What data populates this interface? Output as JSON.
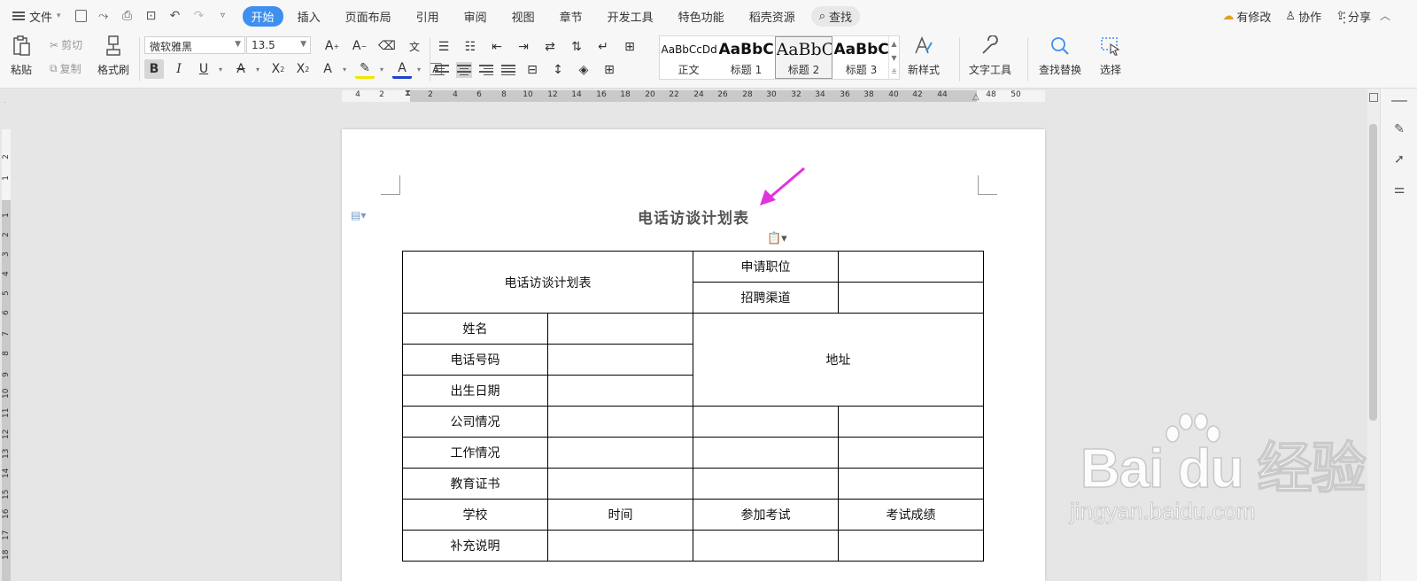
{
  "menubar": {
    "file_label": "文件",
    "tabs": [
      "开始",
      "插入",
      "页面布局",
      "引用",
      "审阅",
      "视图",
      "章节",
      "开发工具",
      "特色功能",
      "稻壳资源"
    ],
    "active_tab": "开始",
    "search_label": "查找",
    "modified_label": "有修改",
    "collab_label": "协作",
    "share_label": "分享"
  },
  "ribbon": {
    "paste_label": "粘贴",
    "cut_label": "剪切",
    "copy_label": "复制",
    "format_painter_label": "格式刷",
    "font_name": "微软雅黑",
    "font_size": "13.5",
    "styles": [
      {
        "sample": "AaBbCcDd",
        "name": "正文"
      },
      {
        "sample": "AaBbC(",
        "name": "标题 1"
      },
      {
        "sample": "AaBbC",
        "name": "标题 2"
      },
      {
        "sample": "AaBbC(",
        "name": "标题 3"
      }
    ],
    "selected_style": "标题 2",
    "new_style_label": "新样式",
    "text_tools_label": "文字工具",
    "find_replace_label": "查找替换",
    "select_label": "选择"
  },
  "ruler": {
    "horizontal_ticks": [
      "4",
      "2",
      "2",
      "4",
      "6",
      "8",
      "10",
      "12",
      "14",
      "16",
      "18",
      "20",
      "22",
      "24",
      "26",
      "28",
      "30",
      "32",
      "34",
      "36",
      "38",
      "40",
      "42",
      "44",
      "48",
      "50"
    ],
    "vertical_ticks": [
      "2",
      "1",
      "1",
      "2",
      "3",
      "4",
      "5",
      "6",
      "7",
      "8",
      "9",
      "10",
      "11",
      "12",
      "13",
      "14",
      "15",
      "16",
      "17",
      "18"
    ]
  },
  "document": {
    "title": "电话访谈计划表",
    "table": {
      "header_title": "电话访谈计划表",
      "position_label": "申请职位",
      "channel_label": "招聘渠道",
      "name_label": "姓名",
      "phone_label": "电话号码",
      "birth_label": "出生日期",
      "address_label": "地址",
      "company_label": "公司情况",
      "work_label": "工作情况",
      "education_label": "教育证书",
      "school_label": "学校",
      "time_label": "时间",
      "exam_label": "参加考试",
      "score_label": "考试成绩",
      "notes_label": "补充说明"
    }
  },
  "watermark": {
    "logo": "Bai du 经验",
    "url": "jingyan.baidu.com"
  },
  "colors": {
    "accent": "#3d8ff0",
    "arrow": "#e033e0"
  }
}
